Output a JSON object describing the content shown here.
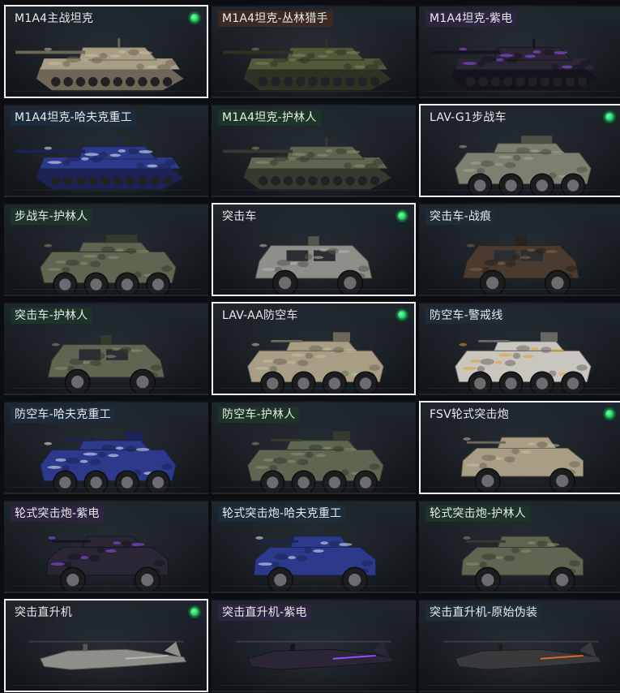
{
  "items": [
    {
      "label": "M1A4主战坦克",
      "type": "tank",
      "camo": "desert",
      "selected": true,
      "equipped": true,
      "tag_color": "#1f2c36"
    },
    {
      "label": "M1A4坦克-丛林猎手",
      "type": "tank",
      "camo": "jungle",
      "selected": false,
      "equipped": false,
      "tag_color": "#3a2a22"
    },
    {
      "label": "M1A4坦克-紫电",
      "type": "tank",
      "camo": "purple",
      "selected": false,
      "equipped": false,
      "tag_color": "#2d2440"
    },
    {
      "label": "M1A4坦克-哈夫克重工",
      "type": "tank",
      "camo": "haavk",
      "selected": false,
      "equipped": false,
      "tag_color": "#1d2c3b"
    },
    {
      "label": "M1A4坦克-护林人",
      "type": "tank",
      "camo": "forest",
      "selected": false,
      "equipped": false,
      "tag_color": "#1d3528"
    },
    {
      "label": "LAV-G1步战车",
      "type": "ifv",
      "camo": "olive",
      "selected": true,
      "equipped": true,
      "tag_color": "#1f2c36"
    },
    {
      "label": "步战车-护林人",
      "type": "ifv",
      "camo": "forest",
      "selected": false,
      "equipped": false,
      "tag_color": "#1d3528"
    },
    {
      "label": "突击车",
      "type": "assault",
      "camo": "grey",
      "selected": true,
      "equipped": true,
      "tag_color": "#1f2c36"
    },
    {
      "label": "突击车-战痕",
      "type": "assault",
      "camo": "rust",
      "selected": false,
      "equipped": false,
      "tag_color": "#1f2c36"
    },
    {
      "label": "突击车-护林人",
      "type": "assault",
      "camo": "forest",
      "selected": false,
      "equipped": false,
      "tag_color": "#1d3528"
    },
    {
      "label": "LAV-AA防空车",
      "type": "aa",
      "camo": "desert",
      "selected": true,
      "equipped": true,
      "tag_color": "#1f2c36"
    },
    {
      "label": "防空车-警戒线",
      "type": "aa",
      "camo": "hazard",
      "selected": false,
      "equipped": false,
      "tag_color": "#1f2c36"
    },
    {
      "label": "防空车-哈夫克重工",
      "type": "aa",
      "camo": "haavk",
      "selected": false,
      "equipped": false,
      "tag_color": "#1d2c3b"
    },
    {
      "label": "防空车-护林人",
      "type": "aa",
      "camo": "forest",
      "selected": false,
      "equipped": false,
      "tag_color": "#1d3528"
    },
    {
      "label": "FSV轮式突击炮",
      "type": "fsv",
      "camo": "desert",
      "selected": true,
      "equipped": true,
      "tag_color": "#1f2c36"
    },
    {
      "label": "轮式突击炮-紫电",
      "type": "fsv",
      "camo": "purple",
      "selected": false,
      "equipped": false,
      "tag_color": "#2d2440"
    },
    {
      "label": "轮式突击炮-哈夫克重工",
      "type": "fsv",
      "camo": "haavk",
      "selected": false,
      "equipped": false,
      "tag_color": "#1d2c3b"
    },
    {
      "label": "轮式突击炮-护林人",
      "type": "fsv",
      "camo": "forest",
      "selected": false,
      "equipped": false,
      "tag_color": "#1d3528"
    },
    {
      "label": "突击直升机",
      "type": "heli",
      "camo": "grey",
      "selected": true,
      "equipped": true,
      "tag_color": "#1f2c36"
    },
    {
      "label": "突击直升机-紫电",
      "type": "heli",
      "camo": "purple",
      "selected": false,
      "equipped": false,
      "tag_color": "#2d2440"
    },
    {
      "label": "突击直升机-原始伪装",
      "type": "heli",
      "camo": "orange",
      "selected": false,
      "equipped": false,
      "tag_color": "#1f2c36"
    }
  ],
  "camo_colors": {
    "desert": {
      "body": "#a89e85",
      "dark": "#6e6656",
      "accent": "#c9bfa4"
    },
    "jungle": {
      "body": "#4f5a3a",
      "dark": "#2b3322",
      "accent": "#7c8a5a"
    },
    "purple": {
      "body": "#2a2636",
      "dark": "#15131c",
      "accent": "#9a4dff"
    },
    "haavk": {
      "body": "#2d3a8c",
      "dark": "#1a2256",
      "accent": "#e8ecf5"
    },
    "forest": {
      "body": "#5c6650",
      "dark": "#343b2e",
      "accent": "#8a9473"
    },
    "olive": {
      "body": "#7c8070",
      "dark": "#4d5045",
      "accent": "#a3a795"
    },
    "grey": {
      "body": "#8d8f88",
      "dark": "#55574f",
      "accent": "#b7b9b1"
    },
    "rust": {
      "body": "#4a3a30",
      "dark": "#2a211b",
      "accent": "#8a6448"
    },
    "hazard": {
      "body": "#c9c5bf",
      "dark": "#6a6762",
      "accent": "#e0a020"
    },
    "orange": {
      "body": "#3a3a3c",
      "dark": "#1e1e20",
      "accent": "#e06a20"
    }
  },
  "wheel_color": "#1c1d1f",
  "wheel_hub": "#6a6c70"
}
